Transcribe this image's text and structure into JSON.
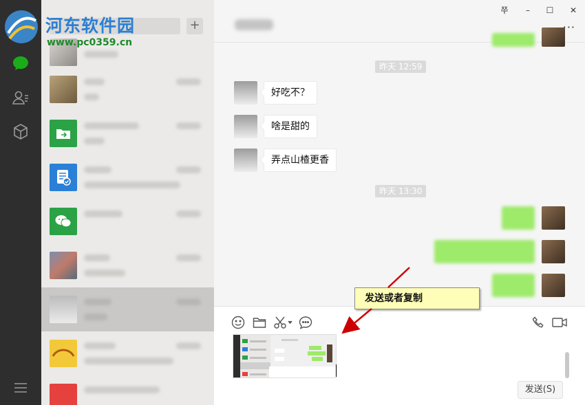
{
  "watermark": {
    "title": "河东软件园",
    "url": "www.pc0359.cn"
  },
  "sidebar": {
    "icons": [
      "chat-icon",
      "contacts-icon",
      "favorites-icon",
      "menu-icon"
    ],
    "active": "chat-icon"
  },
  "chat_list": {
    "add_label": "+",
    "items": [
      {
        "avatar": "photo"
      },
      {
        "avatar": "photo"
      },
      {
        "avatar": "file-transfer-icon"
      },
      {
        "avatar": "subscription-icon"
      },
      {
        "avatar": "wechat-icon"
      },
      {
        "avatar": "group-grid"
      },
      {
        "avatar": "photo",
        "selected": true
      },
      {
        "avatar": "sticker"
      },
      {
        "avatar": "red-icon"
      }
    ]
  },
  "window": {
    "pin_label": "쭈",
    "min_label": "–",
    "max_label": "☐",
    "close_label": "✕",
    "more_label": "···"
  },
  "messages": {
    "timestamps": [
      "昨天 12:59",
      "昨天 13:30"
    ],
    "incoming": [
      "好吃不？",
      "啥是甜的",
      "弄点山楂更香"
    ]
  },
  "annotation": {
    "text": "发送或者复制"
  },
  "toolbar": {
    "send_label": "发送(S)"
  },
  "colors": {
    "rail": "#2e2e2e",
    "list_bg": "#ebeae8",
    "chat_bg": "#f5f5f5",
    "bubble_out": "#9eea6a",
    "accent": "#1aad19",
    "callout_bg": "#fefeb8",
    "arrow": "#cc0000"
  }
}
